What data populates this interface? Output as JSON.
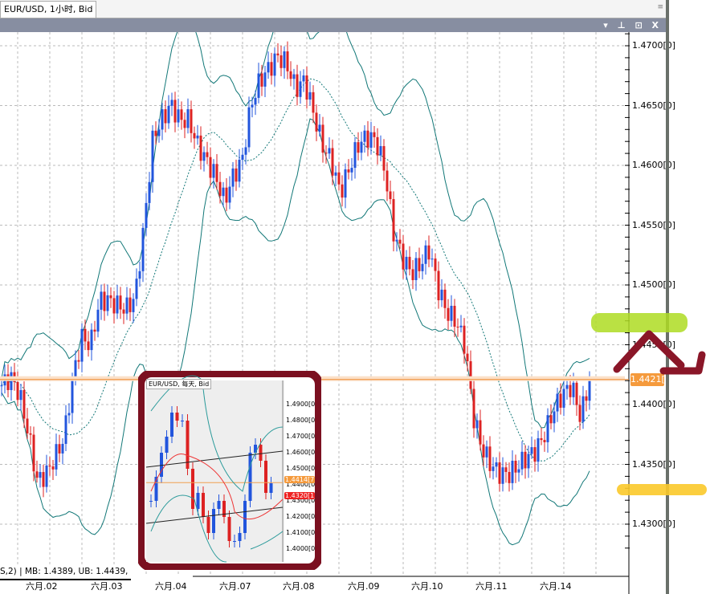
{
  "window": {
    "title": "EUR/USD, 1小时, Bid",
    "buttons": "▾ ⊥ ⊡ X",
    "scroll": "≡"
  },
  "status_text": "S,2) | MB: 1.4389, UB: 1.4439, LB:",
  "price_label": "1.4421[9",
  "colors": {
    "up": "#2255dd",
    "down": "#dd2222",
    "band": "#117777",
    "price_line": "#f0a050"
  },
  "chart_data": {
    "type": "candlestick",
    "symbol": "EUR/USD",
    "timeframe": "1小时",
    "side": "Bid",
    "ylim": [
      1.4265,
      1.4723
    ],
    "y_ticks": [
      "1.4700[0]",
      "1.4650[0]",
      "1.4600[0]",
      "1.4550[0]",
      "1.4500[0]",
      "1.4450[0]",
      "1.4400[0]",
      "1.4350[0]",
      "1.4300[0]"
    ],
    "y_tick_values": [
      1.47,
      1.465,
      1.46,
      1.455,
      1.45,
      1.445,
      1.44,
      1.435,
      1.43
    ],
    "x_labels": [
      "六月.02",
      "六月.03",
      "六月.04",
      "六月.07",
      "六月.08",
      "六月.09",
      "六月.10",
      "六月.11",
      "六月.14"
    ],
    "current_price": 1.4421,
    "close_path": [
      1.4416,
      1.4423,
      1.4409,
      1.4376,
      1.4336,
      1.4342,
      1.4356,
      1.4372,
      1.4423,
      1.4456,
      1.445,
      1.4487,
      1.4487,
      1.4483,
      1.448,
      1.449,
      1.455,
      1.4624,
      1.4638,
      1.4651,
      1.4638,
      1.4638,
      1.4617,
      1.4604,
      1.4591,
      1.457,
      1.4591,
      1.4604,
      1.4651,
      1.4671,
      1.4681,
      1.4691,
      1.4685,
      1.4664,
      1.4671,
      1.4644,
      1.4617,
      1.4604,
      1.4577,
      1.4597,
      1.4617,
      1.4624,
      1.4621,
      1.4597,
      1.4544,
      1.4523,
      1.451,
      1.4517,
      1.453,
      1.4497,
      1.4477,
      1.447,
      1.445,
      1.4389,
      1.4362,
      1.4349,
      1.4342,
      1.4342,
      1.4349,
      1.4356,
      1.4362,
      1.4376,
      1.4396,
      1.4409,
      1.4416,
      1.4389,
      1.4421
    ],
    "indicator": "Bollinger Bands (MB, UB, LB)"
  },
  "inset": {
    "title": "EUR/USD, 每天, Bid",
    "y_ticks": [
      "1.4900[0",
      "1.4800[0",
      "1.4700[0",
      "1.4600[0",
      "1.4500[0",
      "1.4400[0",
      "1.4300[0",
      "1.4200[0",
      "1.4100[0",
      "1.4000[0"
    ],
    "price_label": "1.4414[7",
    "red_label": "1.4320[1"
  }
}
